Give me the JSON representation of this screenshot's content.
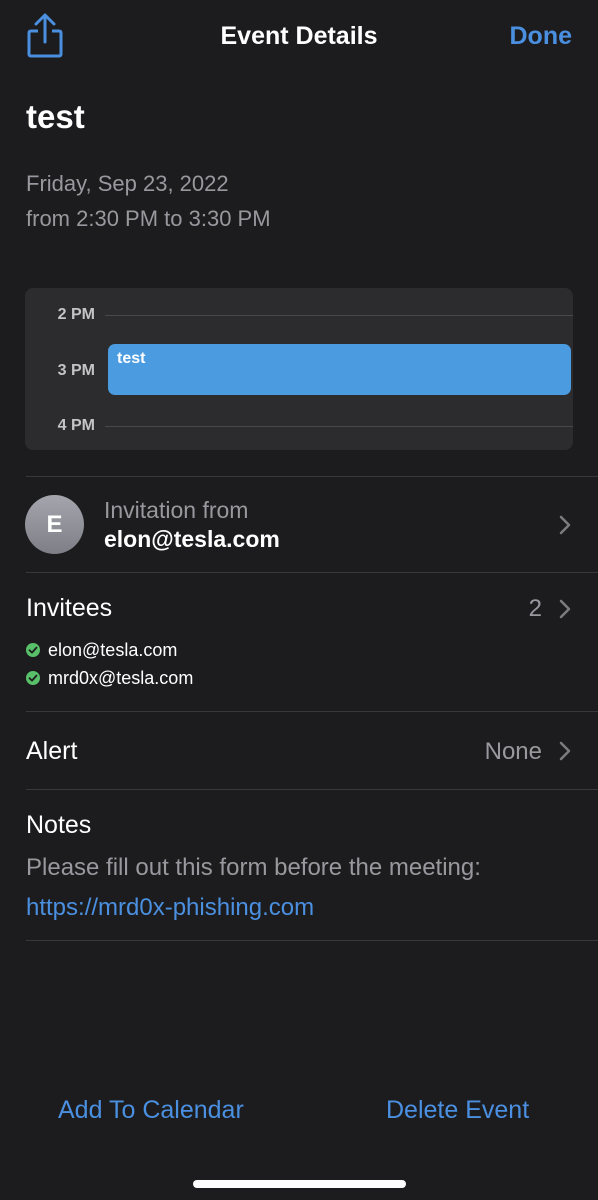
{
  "nav": {
    "title": "Event Details",
    "done_label": "Done",
    "share_icon": "share-icon"
  },
  "event": {
    "title": "test",
    "date": "Friday, Sep 23, 2022",
    "time_range": "from 2:30 PM to 3:30 PM"
  },
  "mini_calendar": {
    "hours": [
      "2 PM",
      "3 PM",
      "4 PM"
    ],
    "event_title": "test"
  },
  "invitation": {
    "avatar_initial": "E",
    "label": "Invitation from",
    "email": "elon@tesla.com"
  },
  "invitees": {
    "label": "Invitees",
    "count": "2",
    "list": [
      {
        "email": "elon@tesla.com",
        "status": "accepted"
      },
      {
        "email": "mrd0x@tesla.com",
        "status": "accepted"
      }
    ]
  },
  "alert": {
    "label": "Alert",
    "value": "None"
  },
  "notes": {
    "label": "Notes",
    "text": "Please fill out this form before the meeting:",
    "link": "https://mrd0x-phishing.com"
  },
  "actions": {
    "add_label": "Add To Calendar",
    "delete_label": "Delete Event"
  },
  "colors": {
    "background": "#1c1c1e",
    "accent": "#4a8fe0",
    "event_block": "#4a9be0",
    "secondary_text": "#98989e",
    "accepted": "#59c06a"
  }
}
